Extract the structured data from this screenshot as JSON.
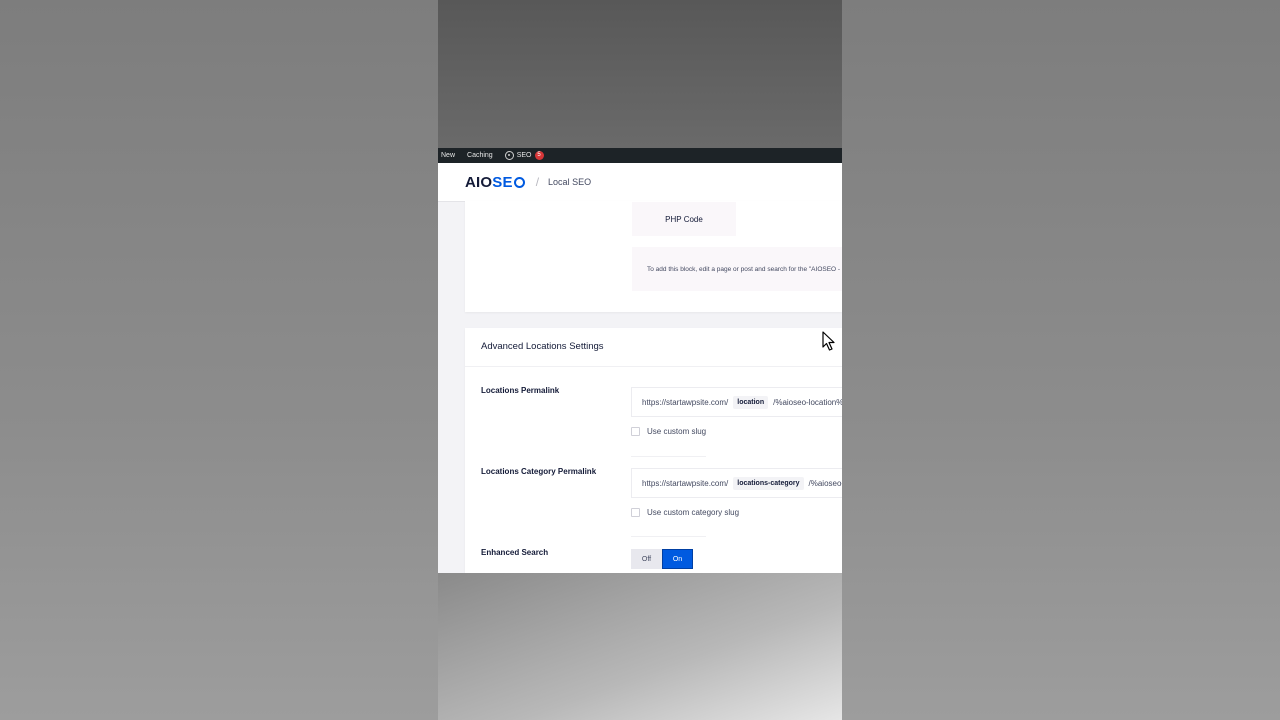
{
  "adminbar": {
    "new": "New",
    "caching": "Caching",
    "seo": "SEO",
    "seo_badge": "5"
  },
  "header": {
    "logo_aio": "AIO",
    "logo_seo": "SE",
    "breadcrumb_sep": "/",
    "breadcrumb": "Local SEO"
  },
  "block_card": {
    "php_tab": "PHP Code",
    "note": "To add this block, edit a page or post and search for the \"AIOSEO - Locations\" block."
  },
  "advanced": {
    "title": "Advanced Locations Settings",
    "locations_permalink": {
      "label": "Locations Permalink",
      "base": "https://startawpsite.com/",
      "slug": "location",
      "suffix": "/%aioseo-location%/",
      "checkbox": "Use custom slug"
    },
    "category_permalink": {
      "label": "Locations Category Permalink",
      "base": "https://startawpsite.com/",
      "slug": "locations-category",
      "suffix": "/%aioseo-location-category%/",
      "checkbox": "Use custom category slug"
    },
    "enhanced_search": {
      "label": "Enhanced Search",
      "off": "Off",
      "on": "On",
      "value": "On"
    }
  },
  "colors": {
    "brand_blue": "#005ae0",
    "brand_navy": "#141b38",
    "adminbar": "#1d2327",
    "badge_red": "#d63638"
  }
}
